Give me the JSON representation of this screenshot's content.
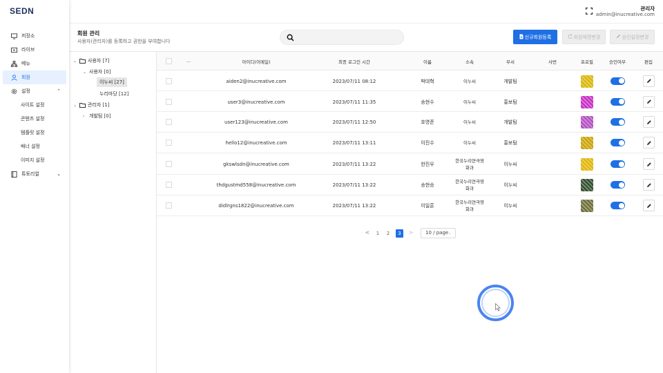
{
  "app": {
    "logo": "SEDN"
  },
  "sidebar": {
    "items": [
      {
        "label": "저장소",
        "icon": "monitor-icon"
      },
      {
        "label": "라이브",
        "icon": "video-icon"
      },
      {
        "label": "메뉴",
        "icon": "tree-icon"
      },
      {
        "label": "회원",
        "icon": "user-icon",
        "active": true
      },
      {
        "label": "설정",
        "icon": "gear-icon",
        "caret": "⌃"
      }
    ],
    "settings_sub": [
      "사이트 설정",
      "콘텐츠 설정",
      "템플릿 설정",
      "배너 설정",
      "이미지 설정"
    ],
    "tutorial": {
      "label": "튜토리얼",
      "icon": "book-icon",
      "caret": "⌄"
    }
  },
  "topbar": {
    "user_name": "관리자",
    "user_email": "admin@inucreative.com"
  },
  "header": {
    "title": "회원 관리",
    "description": "사용자(관리자)를 등록하고 권한을 부여합니다",
    "search_placeholder": "",
    "btn_register": "신규회원등록",
    "btn_reset": "회원재명변경",
    "btn_approve": "승인설정변경"
  },
  "tree": {
    "users": "사용자 [7]",
    "users_sub": "사용자 [0]",
    "inuc": "이누씨 [27]",
    "nuri": "누리마당 [12]",
    "admins": "관리자 [1]",
    "devteam": "개발팀 [0]"
  },
  "table": {
    "headers": {
      "more": "...",
      "id": "아이디(이메일)",
      "last_login": "최종 로그인 시간",
      "name": "이름",
      "org": "소속",
      "dept": "부서",
      "photo": "사번",
      "profile": "프로필",
      "approved": "승인여부",
      "edit": "편집"
    },
    "rows": [
      {
        "id": "aiden2@inucreative.com",
        "last_login": "2023/07/11 08:12",
        "name": "박대혁",
        "org": "이누씨",
        "org2": "",
        "dept": "개발팀",
        "profile_color": "#d9b400",
        "approved": true
      },
      {
        "id": "user3@inucreative.com",
        "last_login": "2023/07/11 11:35",
        "name": "송현수",
        "org": "이누씨",
        "org2": "",
        "dept": "홍보팀",
        "profile_color": "#c72bc2",
        "approved": true
      },
      {
        "id": "user123@inucreative.com",
        "last_login": "2023/07/11 12:50",
        "name": "호영준",
        "org": "이누씨",
        "org2": "",
        "dept": "개발팀",
        "profile_color": "#b04cc0",
        "approved": true
      },
      {
        "id": "hello12@inucreative.com",
        "last_login": "2023/07/11 13:11",
        "name": "이진수",
        "org": "이누씨",
        "org2": "",
        "dept": "홍보팀",
        "profile_color": "#c9a100",
        "approved": true
      },
      {
        "id": "gkswlsdn@inucreative.com",
        "last_login": "2023/07/11 13:22",
        "name": "한진우",
        "org": "한국누리연극영",
        "org2": "화과",
        "dept": "이누씨",
        "profile_color": "#e1b300",
        "approved": true
      },
      {
        "id": "thdgustmd558@inucreative.com",
        "last_login": "2023/07/11 13:22",
        "name": "송현승",
        "org": "한국누리연극영",
        "org2": "화과",
        "dept": "이누씨",
        "profile_color": "#2d4a2a",
        "approved": true
      },
      {
        "id": "didlrgns1822@inucreative.com",
        "last_login": "2023/07/11 13:22",
        "name": "이일훈",
        "org": "한국누리연극영",
        "org2": "화과",
        "dept": "이누씨",
        "profile_color": "#6b6b35",
        "approved": true
      }
    ]
  },
  "pagination": {
    "prev": "<",
    "next": ">",
    "pages": [
      "1",
      "2",
      "3"
    ],
    "current": "3",
    "page_size": "10 / page",
    "page_size_caret": "⌄"
  },
  "colors": {
    "primary": "#1f6fe5",
    "active_bg": "#e6f0ff"
  }
}
